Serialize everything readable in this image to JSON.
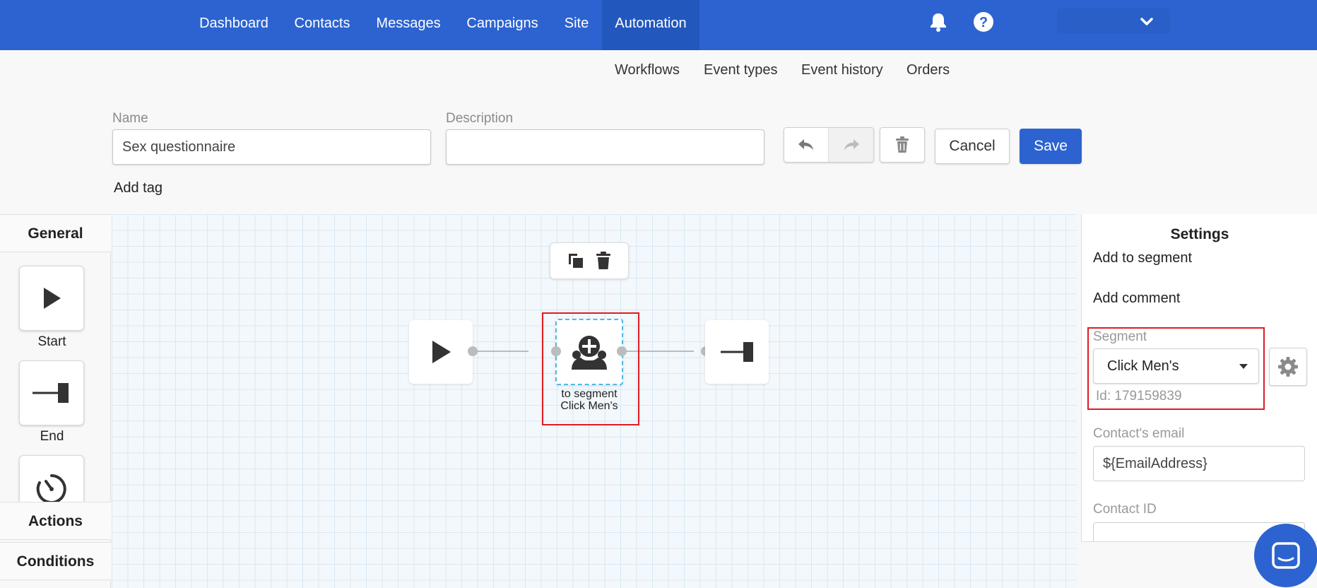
{
  "nav": {
    "items": [
      {
        "label": "Dashboard"
      },
      {
        "label": "Contacts"
      },
      {
        "label": "Messages"
      },
      {
        "label": "Campaigns"
      },
      {
        "label": "Site"
      },
      {
        "label": "Automation",
        "active": true
      }
    ],
    "icons": [
      "bell-icon",
      "help-icon",
      "chevron-down-icon"
    ]
  },
  "subnav": {
    "items": [
      {
        "label": "Workflows"
      },
      {
        "label": "Event types"
      },
      {
        "label": "Event history"
      },
      {
        "label": "Orders"
      }
    ]
  },
  "form": {
    "name_label": "Name",
    "name_value": "Sex questionnaire",
    "description_label": "Description",
    "description_value": "",
    "cancel_label": "Cancel",
    "save_label": "Save",
    "add_tag_label": "Add tag"
  },
  "palette": {
    "general_label": "General",
    "tiles": [
      {
        "label": "Start",
        "icon": "play-icon"
      },
      {
        "label": "End",
        "icon": "end-icon"
      },
      {
        "label": "",
        "icon": "timer-icon"
      }
    ],
    "actions_label": "Actions",
    "conditions_label": "Conditions"
  },
  "canvas": {
    "toolbar_icons": [
      "copy-icon",
      "trash-icon"
    ],
    "nodes": [
      {
        "type": "start",
        "icon": "play-icon"
      },
      {
        "type": "add-to-segment",
        "icon": "add-user-group-icon",
        "caption_line1": "to segment",
        "caption_line2": "Click Men's"
      },
      {
        "type": "end",
        "icon": "end-icon"
      }
    ]
  },
  "settings": {
    "title": "Settings",
    "action_name": "Add to segment",
    "add_comment_label": "Add comment",
    "segment_label": "Segment",
    "segment_value": "Click Men's",
    "segment_id_text": "Id: 179159839",
    "email_label": "Contact's email",
    "email_value": "${EmailAddress}",
    "contact_id_label": "Contact ID",
    "contact_id_value": ""
  },
  "colors": {
    "nav_bg": "#2c63d0",
    "primary": "#2c63d0",
    "highlight": "#e01b24",
    "selection": "#4fb8e8"
  }
}
